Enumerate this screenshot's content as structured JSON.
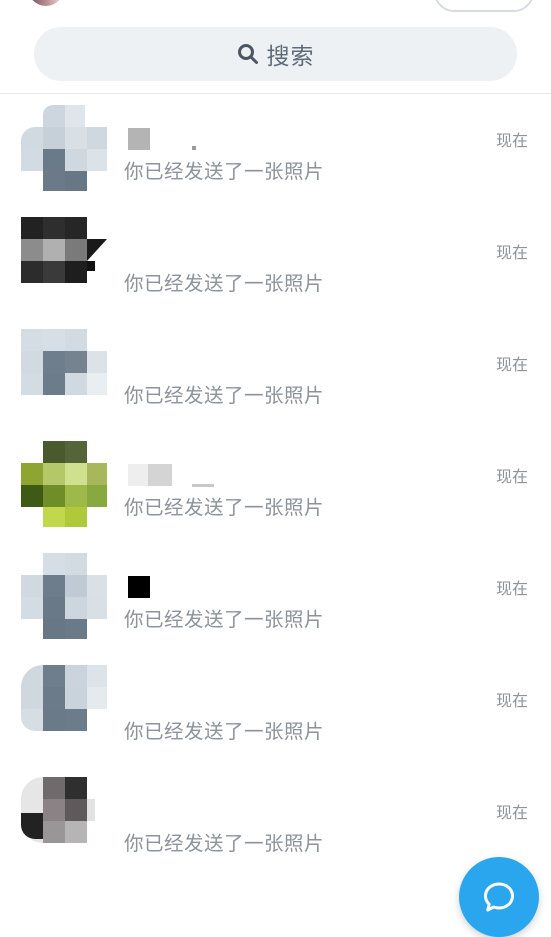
{
  "search": {
    "label": "搜索",
    "icon": "search-icon"
  },
  "conversations": [
    {
      "preview": "你已经发送了一张照片",
      "time": "现在"
    },
    {
      "preview": "你已经发送了一张照片",
      "time": "现在"
    },
    {
      "preview": "你已经发送了一张照片",
      "time": "现在"
    },
    {
      "preview": "你已经发送了一张照片",
      "time": "现在"
    },
    {
      "preview": "你已经发送了一张照片",
      "time": "现在"
    },
    {
      "preview": "你已经发送了一张照片",
      "time": "现在"
    },
    {
      "preview": "你已经发送了一张照片",
      "time": "现在"
    }
  ],
  "compose_button": {
    "icon": "chat-bubble-icon",
    "color": "#2aa6ef"
  },
  "colors": {
    "accent": "#2aa6ef",
    "preview_text": "#8b939b",
    "search_bg": "#eef1f3"
  }
}
